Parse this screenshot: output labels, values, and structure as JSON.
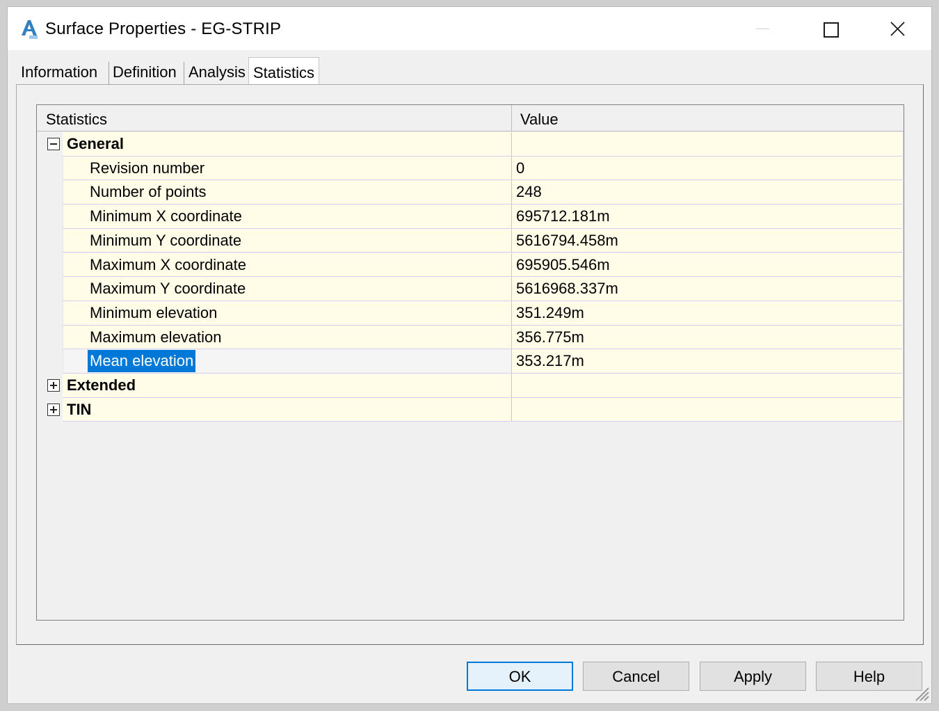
{
  "window": {
    "title": "Surface Properties - EG-STRIP",
    "app_icon": "civil3d-app-icon",
    "controls": [
      "minimize-icon",
      "maximize-icon",
      "close-icon"
    ]
  },
  "tabs": [
    {
      "label": "Information",
      "active": false
    },
    {
      "label": "Definition",
      "active": false
    },
    {
      "label": "Analysis",
      "active": false
    },
    {
      "label": "Statistics",
      "active": true
    }
  ],
  "grid": {
    "columns": {
      "name": "Statistics",
      "value": "Value"
    },
    "general": {
      "label": "General",
      "expanded": true,
      "rows": [
        {
          "name": "Revision number",
          "value": "0"
        },
        {
          "name": "Number of points",
          "value": "248"
        },
        {
          "name": "Minimum X coordinate",
          "value": "695712.181m"
        },
        {
          "name": "Minimum Y coordinate",
          "value": "5616794.458m"
        },
        {
          "name": "Maximum X coordinate",
          "value": "695905.546m"
        },
        {
          "name": "Maximum Y coordinate",
          "value": "5616968.337m"
        },
        {
          "name": "Minimum elevation",
          "value": "351.249m"
        },
        {
          "name": "Maximum elevation",
          "value": "356.775m"
        },
        {
          "name": "Mean elevation",
          "value": "353.217m",
          "selected": true
        }
      ]
    },
    "extended": {
      "label": "Extended",
      "expanded": false
    },
    "tin": {
      "label": "TIN",
      "expanded": false
    }
  },
  "buttons": {
    "ok": "OK",
    "cancel": "Cancel",
    "apply": "Apply",
    "help": "Help"
  },
  "colors": {
    "row_background": "#fffde8",
    "selection": "#0078d7",
    "default_button_border": "#0078d7"
  }
}
